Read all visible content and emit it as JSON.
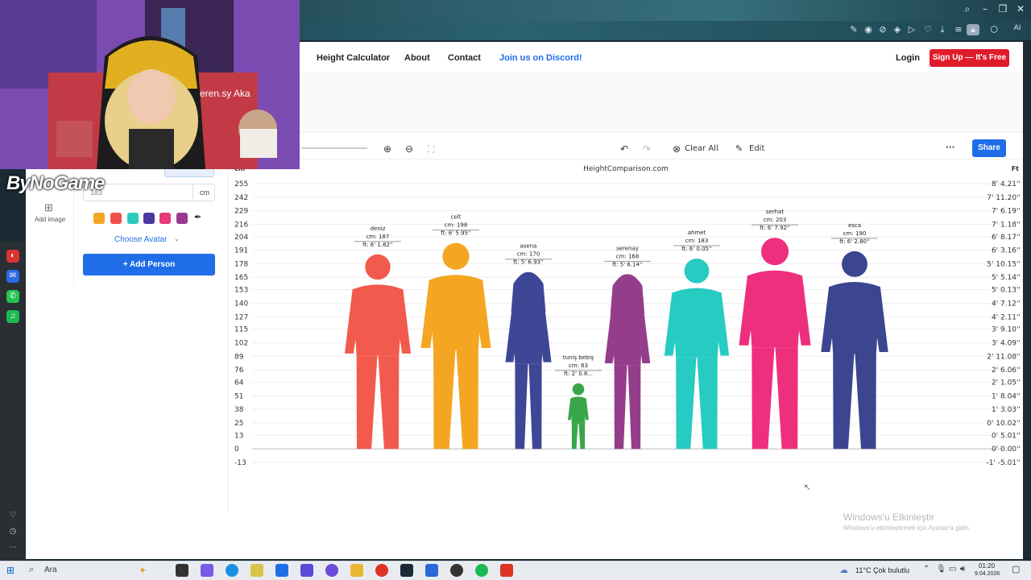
{
  "nav": {
    "links": [
      "Height Calculator",
      "About",
      "Contact",
      "Join us on Discord!"
    ],
    "login": "Login",
    "signup": "Sign Up — It's Free"
  },
  "toolbar": {
    "clear_all": "Clear All",
    "edit": "Edit",
    "share": "Share",
    "more": "···"
  },
  "left_panel": {
    "height_value": "183",
    "unit": "cm",
    "add_image": "Add image",
    "choose_avatar": "Choose Avatar",
    "add_person": "+ Add Person",
    "swatch_colors": [
      "#f4a623",
      "#f2504b",
      "#2ec8c0",
      "#4a3aa0",
      "#e6387a",
      "#9a3a8e"
    ]
  },
  "streamer": {
    "name": "ByNoGame"
  },
  "chart": {
    "site": "HeightComparison.com",
    "left_unit": "cm",
    "right_unit": "Ft",
    "cm_ticks": [
      "255",
      "242",
      "229",
      "216",
      "204",
      "191",
      "178",
      "165",
      "153",
      "140",
      "127",
      "115",
      "102",
      "89",
      "76",
      "64",
      "51",
      "38",
      "25",
      "13",
      "0",
      "-13"
    ],
    "ft_ticks": [
      "8' 4.21''",
      "7' 11.20''",
      "7' 6.19''",
      "7' 1.18''",
      "6' 8.17''",
      "6' 3.16''",
      "5' 10.15''",
      "5' 5.14''",
      "5' 0.13''",
      "4' 7.12''",
      "4' 2.11''",
      "3' 9.10''",
      "3' 4.09''",
      "2' 11.08''",
      "2' 6.06''",
      "2' 1.05''",
      "1' 8.04''",
      "1' 3.03''",
      "0' 10.02''",
      "0' 5.01''",
      "0' 0.00''",
      "-1' -5.01''"
    ]
  },
  "chart_data": {
    "type": "bar",
    "title": "HeightComparison.com",
    "ylabel": "cm",
    "ylim": [
      -13,
      255
    ],
    "categories": [
      "deniz",
      "celt",
      "asena",
      "tuniş bebiş",
      "serenay",
      "ahmet",
      "serhat",
      "esca"
    ],
    "values": [
      187,
      198,
      170,
      63,
      168,
      183,
      203,
      190
    ],
    "people": [
      {
        "name": "deniz",
        "cm": "cm: 187",
        "ft": "ft: 6' 1.62''",
        "color": "#f25a4d",
        "shape": "male"
      },
      {
        "name": "celt",
        "cm": "cm: 198",
        "ft": "ft: 6' 5.95''",
        "color": "#f4a623",
        "shape": "male"
      },
      {
        "name": "asena",
        "cm": "cm: 170",
        "ft": "ft: 5' 6.93''",
        "color": "#3e4796",
        "shape": "female"
      },
      {
        "name": "tuniş bebiş",
        "cm": "cm: 63",
        "ft": "ft: 2' 0.8...",
        "color": "#3aa64a",
        "shape": "child"
      },
      {
        "name": "serenay",
        "cm": "cm: 168",
        "ft": "ft: 5' 6.14''",
        "color": "#943d8a",
        "shape": "female"
      },
      {
        "name": "ahmet",
        "cm": "cm: 183",
        "ft": "ft: 6' 0.05''",
        "color": "#26cbc2",
        "shape": "male"
      },
      {
        "name": "serhat",
        "cm": "cm: 203",
        "ft": "ft: 6' 7.92''",
        "color": "#ee2f7e",
        "shape": "male"
      },
      {
        "name": "esca",
        "cm": "cm: 190",
        "ft": "ft: 6' 2.80''",
        "color": "#3b4590",
        "shape": "male"
      }
    ]
  },
  "windows": {
    "activate_title": "Windows'u Etkinleştir",
    "activate_sub": "Windows'u etkinleştirmek için Ayarlar'a gidin.",
    "search": "Ara",
    "weather": "11°C  Çok bulutlu",
    "time": "01:20",
    "date": "9.04.2026"
  }
}
